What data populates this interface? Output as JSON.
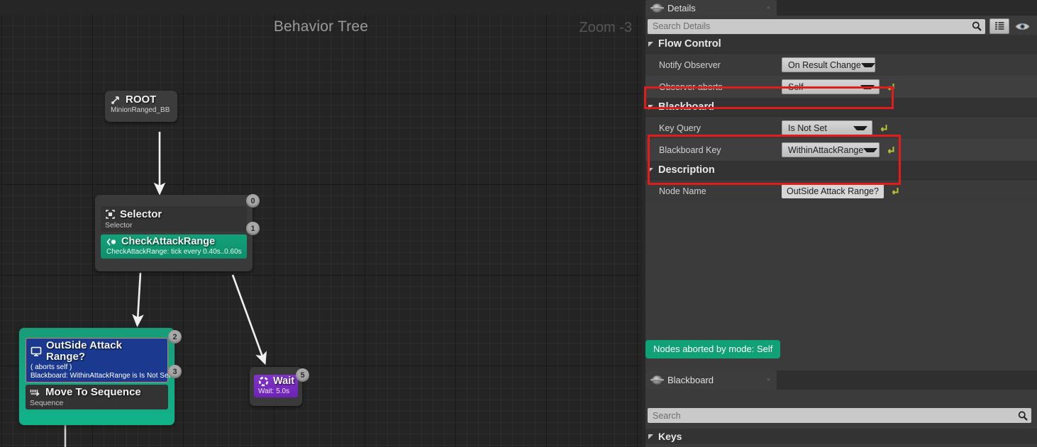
{
  "graph": {
    "title": "Behavior Tree",
    "zoom_label": "Zoom -3",
    "nodes": {
      "root": {
        "title": "ROOT",
        "subtitle": "MinionRanged_BB",
        "icon": "root-arrow-icon"
      },
      "selector": {
        "title": "Selector",
        "subtitle": "Selector",
        "icon": "selector-brackets-icon",
        "index_top": "0",
        "index_bottom": "1",
        "service": {
          "title": "CheckAttackRange",
          "subtitle": "CheckAttackRange: tick every 0.40s..0.60s",
          "icon": "service-diamond-icon"
        }
      },
      "outside": {
        "decorator": {
          "title": "OutSide Attack Range?",
          "subtitle_1": "( aborts self )",
          "subtitle_2": "Blackboard: WithinAttackRange is Is Not Set",
          "icon": "blackboard-monitor-icon"
        },
        "sequence": {
          "title": "Move To Sequence",
          "subtitle": "Sequence",
          "icon": "sequence-steps-icon"
        },
        "index_top": "2",
        "index_bottom": "3"
      },
      "wait": {
        "title": "Wait",
        "subtitle": "Wait: 5.0s",
        "icon": "wait-circle-icon",
        "index": "5"
      }
    }
  },
  "details": {
    "tab_label": "Details",
    "tab_icon": "unreal-chip-icon",
    "close_icon": "close-icon",
    "search": {
      "placeholder": "Search Details",
      "icon": "search-icon"
    },
    "toolbar": {
      "grid_icon": "grid-view-icon",
      "eye_icon": "eye-visibility-icon"
    },
    "sections": [
      {
        "title": "Flow Control",
        "rows": [
          {
            "name": "Notify Observer",
            "value": "On Result Change",
            "control": "dropdown",
            "reset": false,
            "highlight": false
          },
          {
            "name": "Observer aborts",
            "value": "Self",
            "control": "dropdown",
            "reset": true,
            "highlight": true
          }
        ]
      },
      {
        "title": "Blackboard",
        "rows": [
          {
            "name": "Key Query",
            "value": "Is Not Set",
            "control": "dropdown",
            "reset": true,
            "highlight": true
          },
          {
            "name": "Blackboard Key",
            "value": "WithinAttackRange",
            "control": "dropdown",
            "reset": true,
            "highlight": true
          }
        ]
      },
      {
        "title": "Description",
        "rows": [
          {
            "name": "Node Name",
            "value": "OutSide Attack Range?",
            "control": "text",
            "reset": true,
            "highlight": false
          }
        ]
      }
    ],
    "status": "Nodes aborted by mode: Self"
  },
  "blackboard": {
    "tab_label": "Blackboard",
    "tab_icon": "unreal-chip-icon",
    "close_icon": "close-icon",
    "search": {
      "placeholder": "Search",
      "icon": "search-icon"
    },
    "keys_label": "Keys"
  },
  "colors": {
    "accent_green": "#10a177",
    "decorator_blue": "#1b3a8f",
    "task_purple": "#7a2ec0",
    "highlight_red": "#e21b1b",
    "reset_yellow": "#b5c334"
  }
}
